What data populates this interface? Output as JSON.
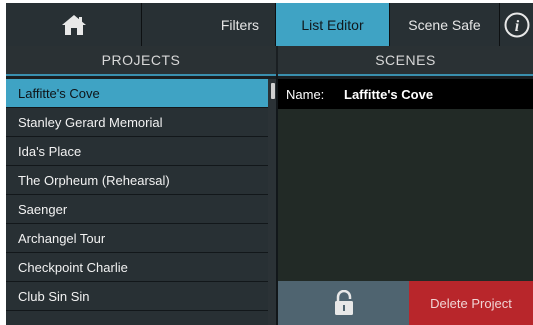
{
  "topbar": {
    "home_icon": "home-icon",
    "filters_label": "Filters",
    "list_editor_label": "List Editor",
    "scene_safe_label": "Scene Safe",
    "info_icon": "info-icon",
    "active_tab": "List Editor",
    "accent_color": "#3fa3c4"
  },
  "projects": {
    "header": "PROJECTS",
    "items": [
      "Laffitte's Cove",
      "Stanley Gerard Memorial",
      "Ida's Place",
      "The Orpheum (Rehearsal)",
      "Saenger",
      "Archangel Tour",
      "Checkpoint Charlie",
      "Club Sin Sin"
    ],
    "selected": "Laffitte's Cove"
  },
  "scenes": {
    "header": "SCENES",
    "name_label": "Name:",
    "name_value": "Laffitte's Cove"
  },
  "footer": {
    "lock_icon": "lock-icon",
    "delete_label": "Delete Project",
    "delete_color": "#b8262b"
  }
}
